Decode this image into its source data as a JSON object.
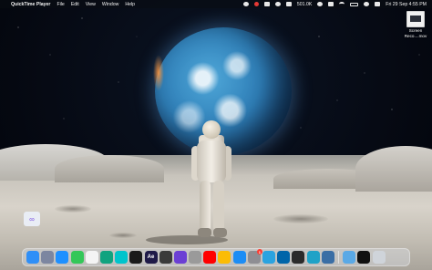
{
  "menubar": {
    "apple_glyph": "",
    "app_name": "QuickTime Player",
    "menus": [
      "File",
      "Edit",
      "View",
      "Window",
      "Help"
    ],
    "status": {
      "network_speed": "501.0K",
      "date_time": "Fri 29 Sep  4:55 PM"
    }
  },
  "desktop": {
    "file": {
      "label_line1": "Screen",
      "label_line2": "Reco....mov"
    }
  },
  "dock": {
    "apps": [
      {
        "name": "Finder",
        "color": "#2f8ff7"
      },
      {
        "name": "Launchpad",
        "color": "#7c86a0"
      },
      {
        "name": "Safari",
        "color": "#1e90ff"
      },
      {
        "name": "Messages",
        "color": "#34c759"
      },
      {
        "name": "Photos",
        "color": "#f4f4f4"
      },
      {
        "name": "ChatGPT",
        "color": "#10a37f"
      },
      {
        "name": "Canva",
        "color": "#00c4cc"
      },
      {
        "name": "Resolve",
        "color": "#1a1a1a"
      },
      {
        "name": "After Effects",
        "label": "Ae",
        "color": "#1f1a48"
      },
      {
        "name": "Final Cut Pro",
        "color": "#3a3a3a"
      },
      {
        "name": "Motion",
        "color": "#6b3fd4"
      },
      {
        "name": "Compressor",
        "color": "#9a9a9a"
      },
      {
        "name": "YouTube",
        "color": "#ff0000"
      },
      {
        "name": "Chrome",
        "color": "#fbbc05"
      },
      {
        "name": "App Store",
        "color": "#1c8df5"
      },
      {
        "name": "System Settings",
        "color": "#8e8e93",
        "badge": "1"
      },
      {
        "name": "Telegram",
        "color": "#2aa3e0"
      },
      {
        "name": "VS Code",
        "color": "#0065a9"
      },
      {
        "name": "Terminal",
        "color": "#2b2b2b"
      },
      {
        "name": "Edge",
        "color": "#1fa2c7"
      },
      {
        "name": "QuickTime Player",
        "color": "#3a6ea5"
      }
    ],
    "right": [
      {
        "name": "Downloads",
        "color": "#5aa9e6"
      },
      {
        "name": "Recent Recording",
        "color": "#101010"
      },
      {
        "name": "Trash",
        "color": "#cfd4da"
      }
    ]
  },
  "colors": {
    "menubar_bg": "#0a0c12",
    "record_indicator": "#e53935"
  }
}
